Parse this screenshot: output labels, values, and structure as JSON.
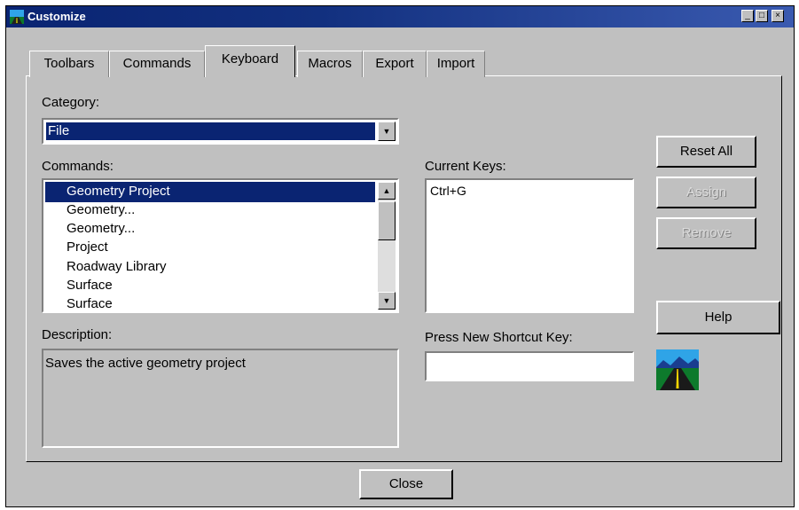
{
  "window": {
    "title": "Customize"
  },
  "titlebar_buttons": {
    "minimize": "_",
    "maximize": "□",
    "close": "×"
  },
  "tabs": [
    {
      "label": "Toolbars",
      "active": false
    },
    {
      "label": "Commands",
      "active": false
    },
    {
      "label": "Keyboard",
      "active": true
    },
    {
      "label": "Macros",
      "active": false
    },
    {
      "label": "Export",
      "active": false
    },
    {
      "label": "Import",
      "active": false
    }
  ],
  "category": {
    "label": "Category:",
    "value": "File"
  },
  "commands": {
    "label": "Commands:",
    "items": [
      "Geometry Project",
      "Geometry...",
      "Geometry...",
      "Project",
      "Roadway Library",
      "Surface",
      "Surface"
    ],
    "selected_index": 0
  },
  "description": {
    "label": "Description:",
    "text": "Saves the active geometry project"
  },
  "current_keys": {
    "label": "Current Keys:",
    "items": [
      "Ctrl+G"
    ]
  },
  "shortcut": {
    "label": "Press New Shortcut Key:",
    "value": ""
  },
  "buttons": {
    "reset_all": "Reset All",
    "assign": "Assign",
    "remove": "Remove",
    "help": "Help",
    "close": "Close"
  },
  "colors": {
    "selection": "#0a2472",
    "face": "#c0c0c0"
  }
}
